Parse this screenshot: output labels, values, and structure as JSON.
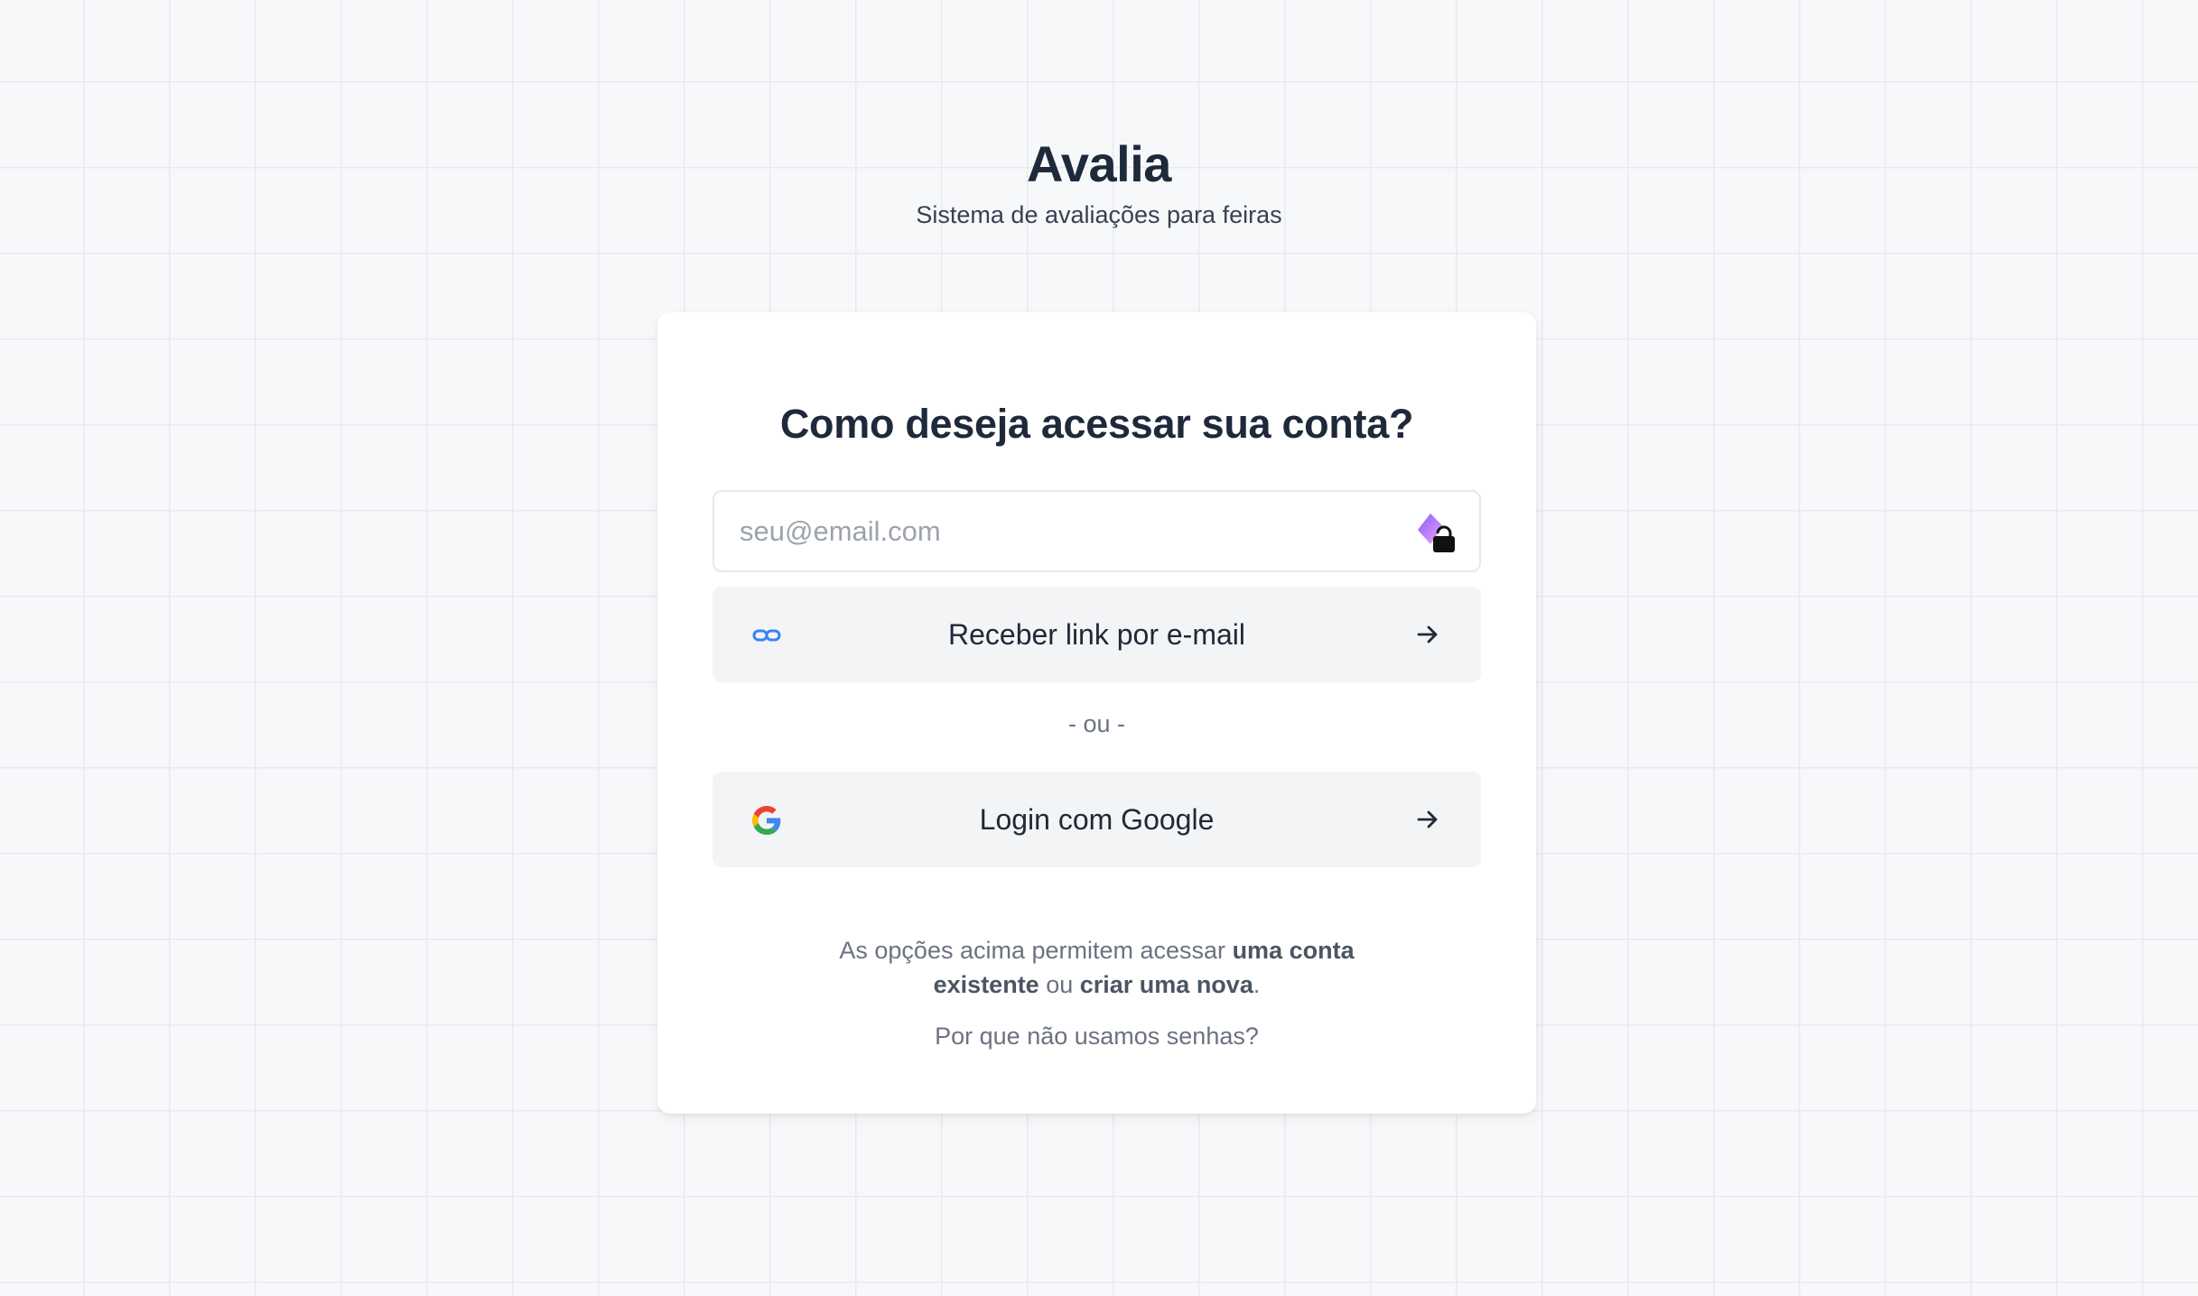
{
  "app": {
    "title": "Avalia",
    "subtitle": "Sistema de avaliações para feiras"
  },
  "login": {
    "heading": "Como deseja acessar sua conta?",
    "email_placeholder": "seu@email.com",
    "email_value": "",
    "magic_link_label": "Receber link por e-mail",
    "divider": "- ou -",
    "google_label": "Login com Google",
    "note": {
      "prefix": "As opções acima permitem acessar ",
      "bold1": "uma conta existente",
      "middle": " ou ",
      "bold2": "criar uma nova",
      "suffix": "."
    },
    "why_no_passwords": "Por que não usamos senhas?"
  },
  "icons": {
    "password_manager": "password-manager-lock-icon",
    "magic_link": "link-icon",
    "google": "google-logo-icon",
    "arrow": "arrow-right-icon"
  },
  "colors": {
    "background": "#f7f8fa",
    "card": "#ffffff",
    "button_bg": "#f3f4f6",
    "heading": "#1e293b",
    "muted": "#6b7280",
    "link_icon": "#3b82f6"
  }
}
